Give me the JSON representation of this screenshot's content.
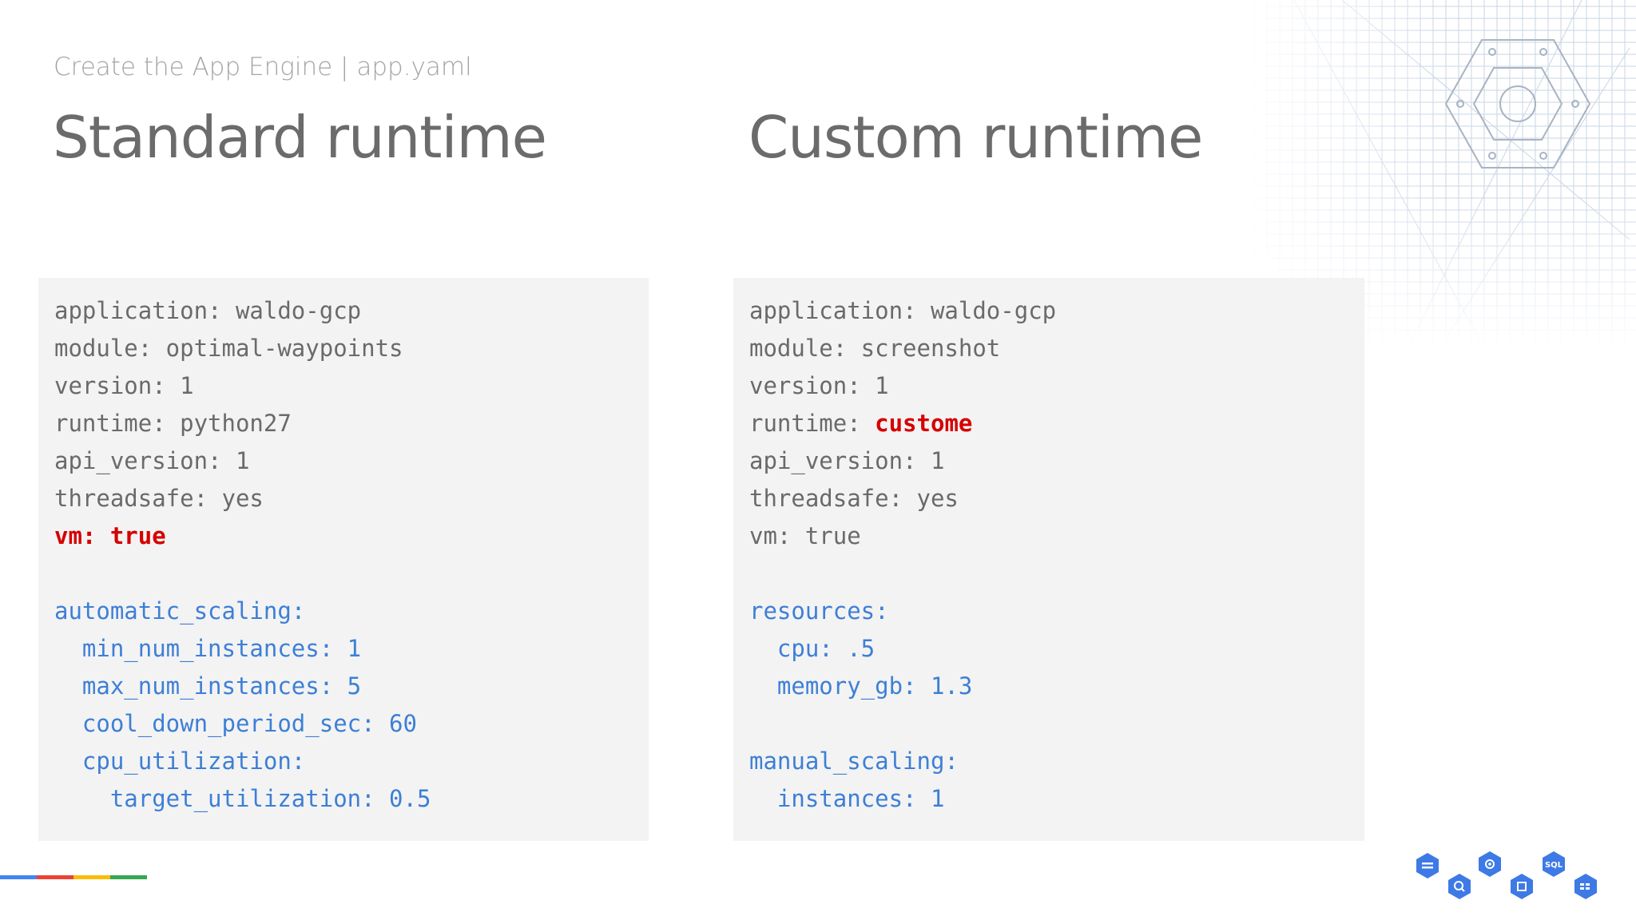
{
  "slide": {
    "subtitle": "Create the App Engine | app.yaml",
    "left_title": "Standard runtime",
    "right_title": "Custom runtime"
  },
  "left_panel": {
    "lines": [
      {
        "text": "application: waldo-gcp",
        "style": "normal"
      },
      {
        "text": "module: optimal-waypoints",
        "style": "normal"
      },
      {
        "text": "version: 1",
        "style": "normal"
      },
      {
        "text": "runtime: python27",
        "style": "normal"
      },
      {
        "text": "api_version: 1",
        "style": "normal"
      },
      {
        "text": "threadsafe: yes",
        "style": "normal"
      },
      {
        "text": "vm: true",
        "style": "highlight"
      },
      {
        "text": "",
        "style": "blank"
      },
      {
        "text": "automatic_scaling:",
        "style": "blue"
      },
      {
        "text": "  min_num_instances: 1",
        "style": "blue"
      },
      {
        "text": "  max_num_instances: 5",
        "style": "blue"
      },
      {
        "text": "  cool_down_period_sec: 60",
        "style": "blue"
      },
      {
        "text": "  cpu_utilization:",
        "style": "blue"
      },
      {
        "text": "    target_utilization: 0.5",
        "style": "blue"
      }
    ]
  },
  "right_panel": {
    "line1": "application: waldo-gcp",
    "line2": "module: screenshot",
    "line3": "version: 1",
    "line4_key": "runtime: ",
    "line4_value": "custome",
    "line5": "api_version: 1",
    "line6": "threadsafe: yes",
    "line7": "vm: true",
    "line9": "resources:",
    "line10": "  cpu: .5",
    "line11": "  memory_gb: 1.3",
    "line13": "manual_scaling:",
    "line14": "  instances: 1"
  },
  "icons": {
    "logo": "cloud-platform-hexagon-logo",
    "services": [
      "storage-icon",
      "bigquery-icon",
      "pubsub-icon",
      "compute-engine-icon",
      "cloud-sql-icon",
      "dataproc-icon"
    ],
    "service_sql_label": "SQL"
  },
  "colors": {
    "highlight": "#d50000",
    "blue": "#3d7fd6",
    "bar": [
      "#4285f4",
      "#ea4335",
      "#fbbc05",
      "#34a853"
    ],
    "icon_blue": "#3e7ae6"
  }
}
